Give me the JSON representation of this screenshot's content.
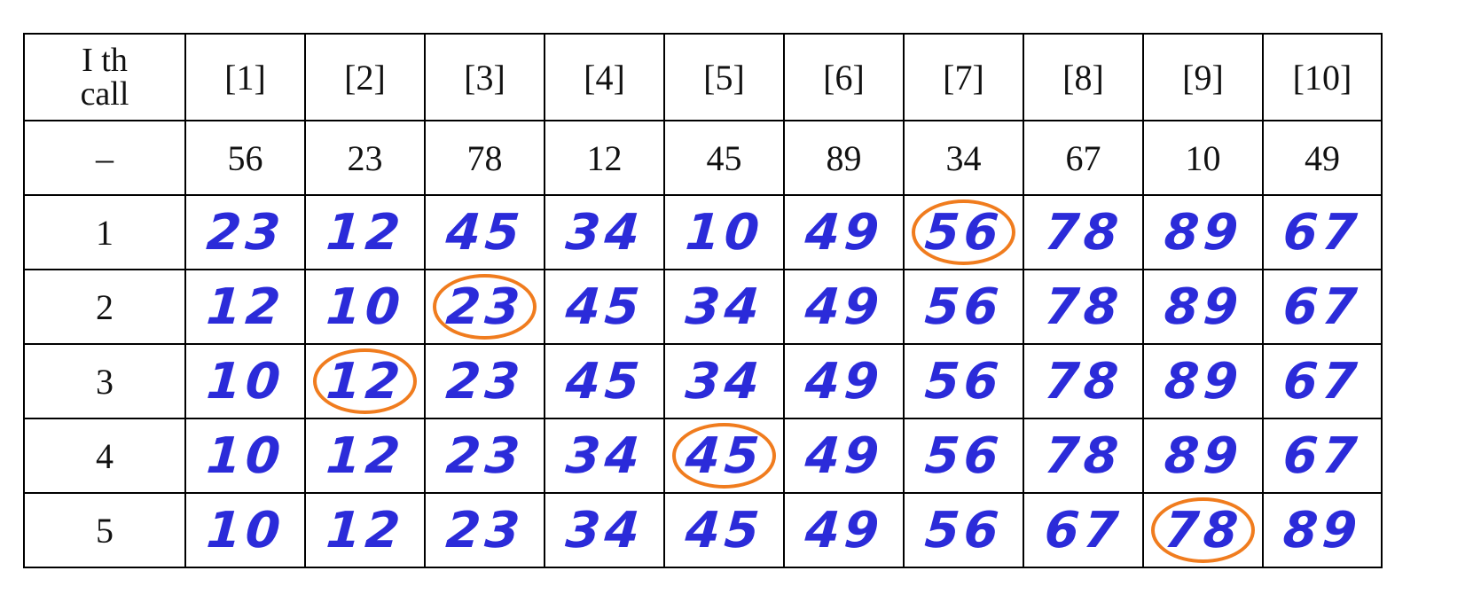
{
  "table": {
    "corner_header": "I th\ncall",
    "index_headers": [
      "[1]",
      "[2]",
      "[3]",
      "[4]",
      "[5]",
      "[6]",
      "[7]",
      "[8]",
      "[9]",
      "[10]"
    ],
    "initial_row": {
      "label": "–",
      "values": [
        "56",
        "23",
        "78",
        "12",
        "45",
        "89",
        "34",
        "67",
        "10",
        "49"
      ]
    },
    "passes": [
      {
        "label": "1",
        "values": [
          "23",
          "12",
          "45",
          "34",
          "10",
          "49",
          "56",
          "78",
          "89",
          "67"
        ],
        "circled_index": 6
      },
      {
        "label": "2",
        "values": [
          "12",
          "10",
          "23",
          "45",
          "34",
          "49",
          "56",
          "78",
          "89",
          "67"
        ],
        "circled_index": 2
      },
      {
        "label": "3",
        "values": [
          "10",
          "12",
          "23",
          "45",
          "34",
          "49",
          "56",
          "78",
          "89",
          "67"
        ],
        "circled_index": 1
      },
      {
        "label": "4",
        "values": [
          "10",
          "12",
          "23",
          "34",
          "45",
          "49",
          "56",
          "78",
          "89",
          "67"
        ],
        "circled_index": 4
      },
      {
        "label": "5",
        "values": [
          "10",
          "12",
          "23",
          "34",
          "45",
          "49",
          "56",
          "67",
          "78",
          "89"
        ],
        "circled_index": 8
      }
    ]
  },
  "colors": {
    "handwriting": "#2b2bd9",
    "circle": "#f07c1e",
    "grid": "#000000"
  }
}
